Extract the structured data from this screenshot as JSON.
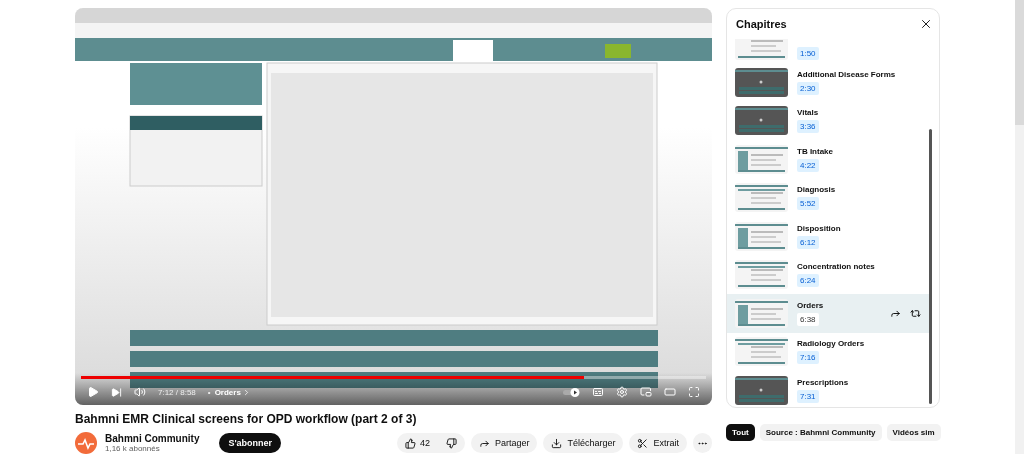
{
  "video": {
    "kind": "picture",
    "player": {
      "level": 0.805,
      "time": "7:12 / 8:58",
      "separator": "•",
      "chapter": "Orders"
    }
  },
  "title": "Bahmni EMR Clinical screens for OPD workflow (part 2 of 3)",
  "channel": {
    "name": "Bahmni Community",
    "subscribers": "1,16 k abonnés",
    "subscribe": "S'abonner"
  },
  "actions": {
    "likes": "42",
    "share": "Partager",
    "download": "Télécharger",
    "clip": "Extrait"
  },
  "chapters": {
    "title": "Chapitres",
    "items": [
      {
        "time": "1:50",
        "selected": false
      },
      {
        "title": "Additional Disease Forms",
        "time": "2:30",
        "selected": false
      },
      {
        "title": "Vitals",
        "time": "3:36",
        "selected": false
      },
      {
        "title": "TB Intake",
        "time": "4:22",
        "selected": false
      },
      {
        "title": "Diagnosis",
        "time": "5:52",
        "selected": false
      },
      {
        "title": "Disposition",
        "time": "6:12",
        "selected": false
      },
      {
        "title": "Concentration notes",
        "time": "6:24",
        "selected": false
      },
      {
        "title": "Orders",
        "time": "6:38",
        "selected": true
      },
      {
        "title": "Radiology Orders",
        "time": "7:16",
        "selected": false
      },
      {
        "title": "Prescriptions",
        "time": "7:31",
        "selected": false
      }
    ]
  },
  "chips": [
    {
      "label": "Tout",
      "selected": true
    },
    {
      "label": "Source : Bahmni Community",
      "selected": false
    },
    {
      "label": "Vidéos sim",
      "selected": false
    }
  ]
}
